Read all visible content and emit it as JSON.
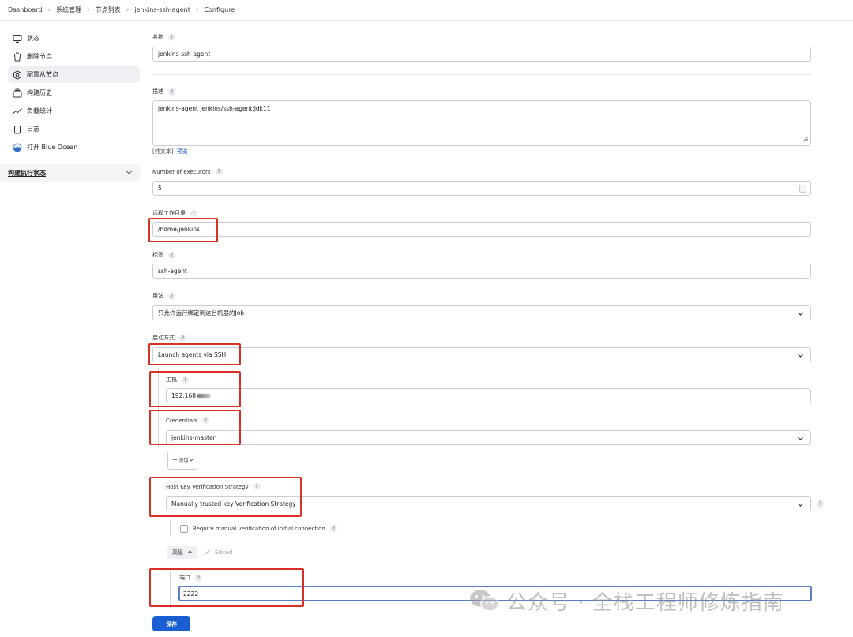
{
  "breadcrumb": [
    "Dashboard",
    "系统管理",
    "节点列表",
    "jenkins-ssh-agent",
    "Configure"
  ],
  "sidebar": {
    "items": [
      {
        "label": "状态",
        "icon": "monitor-icon"
      },
      {
        "label": "删除节点",
        "icon": "trash-icon"
      },
      {
        "label": "配置从节点",
        "icon": "gear-icon"
      },
      {
        "label": "构建历史",
        "icon": "history-icon"
      },
      {
        "label": "负载统计",
        "icon": "trend-icon"
      },
      {
        "label": "日志",
        "icon": "clipboard-icon"
      },
      {
        "label": "打开 Blue Ocean",
        "icon": "blue-ocean-icon"
      }
    ],
    "active_index": 2,
    "executor_panel": {
      "label": "构建执行状态"
    }
  },
  "form": {
    "name": {
      "label": "名称",
      "value": "jenkins-ssh-agent"
    },
    "description": {
      "label": "描述",
      "value": "jenkins-agent  jenkins/ssh-agent:jdk11",
      "plain_text": "[纯文本]",
      "preview": "预览"
    },
    "executors": {
      "label": "Number of executors",
      "value": "5"
    },
    "remote_dir": {
      "label": "远程工作目录",
      "value": "/home/jenkins"
    },
    "labels": {
      "label": "标签",
      "value": "ssh-agent"
    },
    "usage": {
      "label": "用法",
      "value": "只允许运行绑定到这台机器的Job"
    },
    "launch": {
      "label": "启动方式",
      "value": "Launch agents via SSH"
    },
    "host": {
      "label": "主机",
      "value": "192.168"
    },
    "credentials": {
      "label": "Credentials",
      "value": "jenkins-master"
    },
    "add_button": {
      "label": "添加"
    },
    "host_key": {
      "label": "Host Key Verification Strategy",
      "value": "Manually trusted key Verification Strategy"
    },
    "require_manual": {
      "label": "Require manual verification of initial connection"
    },
    "advanced": {
      "label": "高级",
      "edited": "Edited"
    },
    "port": {
      "label": "端口",
      "value": "2222"
    },
    "save": {
      "label": "保存"
    },
    "help": "?"
  },
  "watermark": {
    "text": "公众号 · 全栈工程师修炼指南"
  }
}
